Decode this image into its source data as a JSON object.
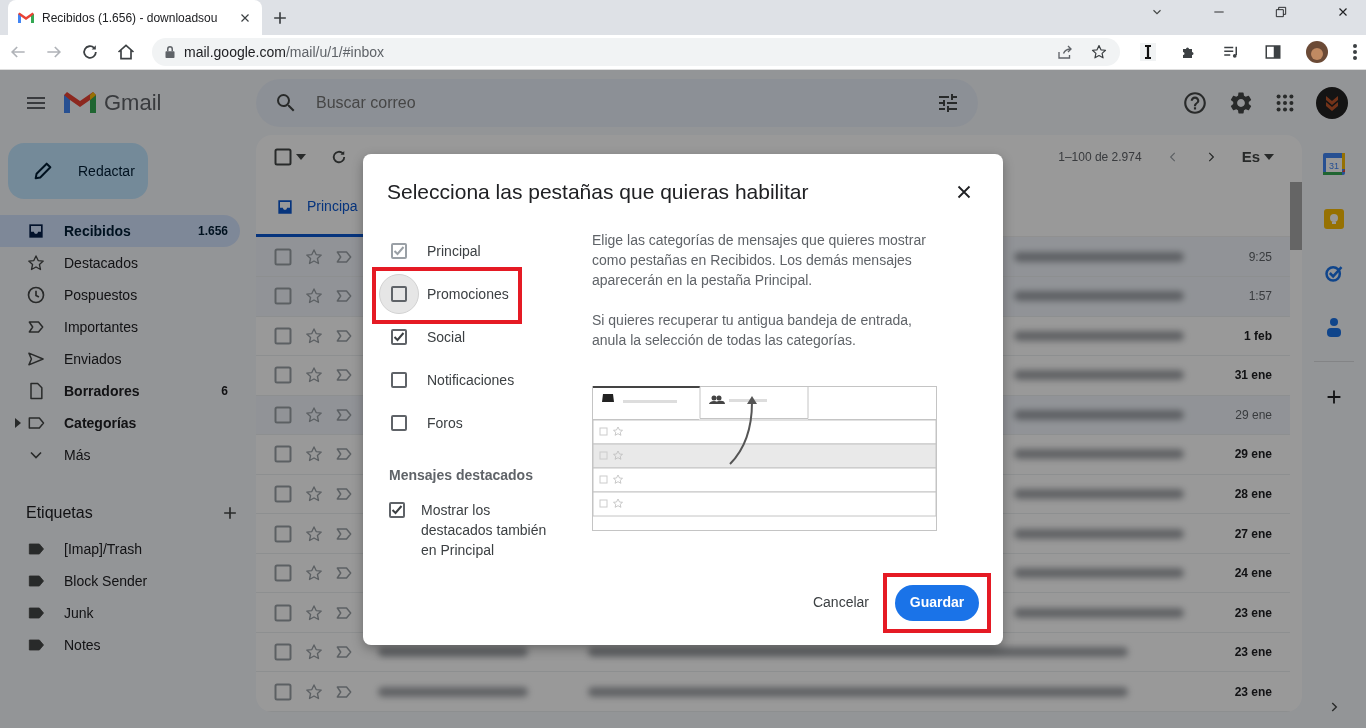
{
  "browser": {
    "tab": {
      "title": "Recibidos (1.656) - downloadsou"
    },
    "url": {
      "host": "mail.google.com",
      "path": "/mail/u/1/#inbox"
    }
  },
  "header": {
    "app_name": "Gmail",
    "search": {
      "placeholder": "Buscar correo"
    }
  },
  "sidebar": {
    "compose": "Redactar",
    "items": [
      {
        "label": "Recibidos",
        "count": "1.656",
        "kind": "inbox",
        "selected": true,
        "bold": true
      },
      {
        "label": "Destacados",
        "kind": "star",
        "selected": false,
        "bold": false
      },
      {
        "label": "Pospuestos",
        "kind": "clock",
        "selected": false,
        "bold": false
      },
      {
        "label": "Importantes",
        "kind": "important",
        "selected": false,
        "bold": false
      },
      {
        "label": "Enviados",
        "kind": "send",
        "selected": false,
        "bold": false
      },
      {
        "label": "Borradores",
        "count": "6",
        "kind": "draft",
        "selected": false,
        "bold": true
      },
      {
        "label": "Categorías",
        "kind": "categories",
        "selected": false,
        "bold": true
      },
      {
        "label": "Más",
        "kind": "more",
        "selected": false,
        "bold": false
      }
    ],
    "labels_title": "Etiquetas",
    "labels": [
      {
        "label": "[Imap]/Trash"
      },
      {
        "label": "Block Sender"
      },
      {
        "label": "Junk"
      },
      {
        "label": "Notes"
      }
    ]
  },
  "toolbar": {
    "pagination": "1–100 de 2.974",
    "input_tool": "Es"
  },
  "inbox_tabs": [
    {
      "label": "Principa",
      "selected": true
    }
  ],
  "emails": [
    {
      "date": "9:25",
      "unread": false
    },
    {
      "date": "1:57",
      "unread": false
    },
    {
      "date": "1 feb",
      "unread": true
    },
    {
      "date": "31 ene",
      "unread": true
    },
    {
      "date": "29 ene",
      "unread": false
    },
    {
      "date": "29 ene",
      "unread": true
    },
    {
      "date": "28 ene",
      "unread": true
    },
    {
      "date": "27 ene",
      "unread": true
    },
    {
      "date": "24 ene",
      "unread": true
    },
    {
      "date": "23 ene",
      "unread": true
    },
    {
      "date": "23 ene",
      "unread": true
    },
    {
      "date": "23 ene",
      "unread": true
    }
  ],
  "right_rail": {
    "calendar_day": "31"
  },
  "dialog": {
    "title": "Selecciona las pestañas que quieras habilitar",
    "categories": [
      {
        "label": "Principal",
        "checked": true,
        "disabled": true,
        "focused": false,
        "highlighted": false
      },
      {
        "label": "Promociones",
        "checked": false,
        "disabled": false,
        "focused": true,
        "highlighted": true
      },
      {
        "label": "Social",
        "checked": true,
        "disabled": false,
        "focused": false,
        "highlighted": false
      },
      {
        "label": "Notificaciones",
        "checked": false,
        "disabled": false,
        "focused": false,
        "highlighted": false
      },
      {
        "label": "Foros",
        "checked": false,
        "disabled": false,
        "focused": false,
        "highlighted": false
      }
    ],
    "starred_section": {
      "title": "Mensajes destacados",
      "option": {
        "label": "Mostrar los destacados también en Principal",
        "checked": true
      }
    },
    "description": [
      "Elige las categorías de mensajes que quieres mostrar como pestañas en Recibidos. Los demás mensajes aparecerán en la pestaña Principal.",
      "Si quieres recuperar tu antigua bandeja de entrada, anula la selección de todas las categorías."
    ],
    "buttons": [
      {
        "label": "Cancelar",
        "kind": "text",
        "highlighted": false
      },
      {
        "label": "Guardar",
        "kind": "primary",
        "highlighted": true
      }
    ]
  }
}
